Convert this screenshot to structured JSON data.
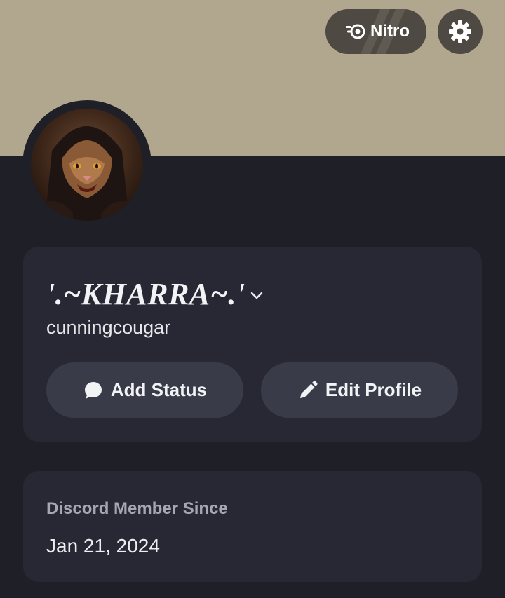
{
  "colors": {
    "banner": "#b1a68e",
    "background": "#1f1f27",
    "card": "#272833",
    "button": "#393b49",
    "header_button": "#4e4a43"
  },
  "header": {
    "nitro_label": "Nitro",
    "nitro_icon": "nitro-icon",
    "settings_icon": "gear-icon"
  },
  "profile": {
    "display_name": "'.~KHARRA~.'",
    "username": "cunningcougar",
    "add_status_label": "Add Status",
    "add_status_icon": "speech-bubble-icon",
    "edit_profile_label": "Edit Profile",
    "edit_profile_icon": "pencil-icon"
  },
  "member_since": {
    "label": "Discord Member Since",
    "date": "Jan 21, 2024"
  }
}
